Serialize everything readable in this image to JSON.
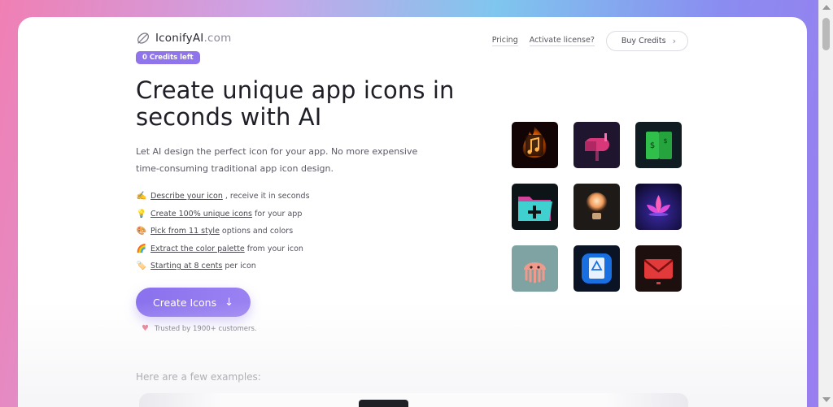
{
  "brand": {
    "name": "IconifyAI",
    "domain": ".com"
  },
  "credits_badge": "0 Credits left",
  "nav": {
    "pricing": "Pricing",
    "activate": "Activate license?",
    "buy_credits": "Buy Credits"
  },
  "hero": {
    "headline": "Create unique app icons in seconds with AI",
    "subtext": "Let AI design the perfect icon for your app. No more expensive time-consuming traditional app icon design."
  },
  "features": [
    {
      "emoji": "✍️",
      "link": "Describe your icon",
      "rest": ", receive it in seconds"
    },
    {
      "emoji": "💡",
      "link": "Create 100% unique icons",
      "rest": " for your app"
    },
    {
      "emoji": "🎨",
      "link": "Pick from 11 style",
      "rest": " options and colors"
    },
    {
      "emoji": "🌈",
      "link": "Extract the color palette",
      "rest": " from your icon"
    },
    {
      "emoji": "🏷️",
      "link": "Starting at 8 cents",
      "rest": " per icon"
    }
  ],
  "cta": {
    "label": "Create Icons",
    "arrow": "↓"
  },
  "trusted": "Trusted by 1900+ customers.",
  "examples_title": "Here are a few examples:",
  "icons": [
    "music-flame-icon",
    "mailbox-icon",
    "money-book-icon",
    "folder-plus-icon",
    "lightbulb-icon",
    "lotus-icon",
    "jellyfish-icon",
    "blue-document-icon",
    "red-envelope-icon"
  ],
  "colors": {
    "accent": "#8f74ec",
    "text": "#1f1f27",
    "muted": "#5a5a66"
  }
}
